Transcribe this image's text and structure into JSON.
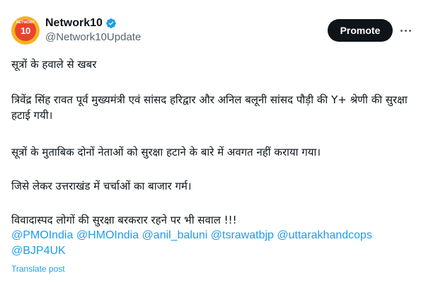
{
  "author": {
    "avatar_top_text": "NETWORK",
    "avatar_text": "10",
    "display_name": "Network10",
    "handle": "@Network10Update",
    "verified_color": "#1d9bf0"
  },
  "actions": {
    "promote_label": "Promote",
    "more_icon": "more-horizontal-icon"
  },
  "post": {
    "line1": "सूत्रों के हवाले से खबर",
    "para2": "त्रिवेंद्र सिंह रावत पूर्व मुख्यमंत्री एवं सांसद हरिद्वार और अनिल बलूनी सांसद पौड़ी की Y+ श्रेणी की सुरक्षा हटाई गयी।",
    "para3": "सूत्रों के मुताबिक दोनों नेताओं को सुरक्षा हटाने के बारे में अवगत नहीं कराया गया।",
    "para4": "जिसे लेकर उत्तराखंड में चर्चाओं का बाजार गर्म।",
    "para5": "विवादास्पद लोगों की सुरक्षा बरकरार रहने पर भी सवाल !!!",
    "mentions": [
      "@PMOIndia",
      "@HMOIndia",
      "@anil_baluni",
      "@tsrawatbjp",
      "@uttarakhandcops",
      "@BJP4UK"
    ]
  },
  "translate_label": "Translate post",
  "colors": {
    "link": "#1d9bf0",
    "text": "#0f1419",
    "secondary": "#536471",
    "avatar_bg": "#f7b21f",
    "avatar_inner": "#e8442c"
  }
}
